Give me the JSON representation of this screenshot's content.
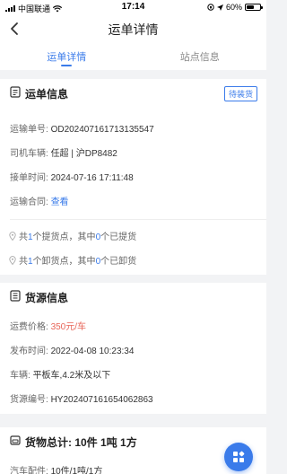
{
  "status_bar": {
    "carrier": "中国联通",
    "time": "17:14",
    "battery": "60%",
    "battery_level": 0.6
  },
  "nav": {
    "title": "运单详情"
  },
  "tabs": [
    {
      "label": "运单详情",
      "active": true
    },
    {
      "label": "站点信息",
      "active": false
    }
  ],
  "waybill": {
    "title": "运单信息",
    "status_badge": "待装货",
    "fields": [
      {
        "label": "运输单号:",
        "value": "OD202407161713135547"
      },
      {
        "label": "司机车辆:",
        "value": "任超 | 沪DP8482"
      },
      {
        "label": "接单时间:",
        "value": "2024-07-16 17:11:48"
      },
      {
        "label": "运输合同:",
        "value": "查看"
      }
    ],
    "pickup": {
      "pre": "共",
      "total": "1",
      "mid": "个提货点，其中",
      "done": "0",
      "post": "个已提货"
    },
    "unload": {
      "pre": "共",
      "total": "1",
      "mid": "个卸货点，其中",
      "done": "0",
      "post": "个已卸货"
    }
  },
  "cargo": {
    "title": "货源信息",
    "fields": [
      {
        "label": "运费价格:",
        "value": "350元/车"
      },
      {
        "label": "发布时间:",
        "value": "2022-04-08 10:23:34"
      },
      {
        "label": "车辆:",
        "value": "平板车,4.2米及以下"
      },
      {
        "label": "货源编号:",
        "value": "HY202407161654062863"
      }
    ]
  },
  "goods": {
    "title": "货物总计: 10件 1吨 1方",
    "item_label": "汽车配件:",
    "item_value": "10件/1吨/1方"
  },
  "icons": {
    "back": "chevron-left-icon",
    "waybill": "document-icon",
    "cargo": "list-icon",
    "goods": "box-icon",
    "pin": "location-pin-icon",
    "fab": "apps-icon"
  },
  "colors": {
    "accent": "#3a7bea",
    "price": "#e8675a",
    "background": "#f2f3f5"
  }
}
